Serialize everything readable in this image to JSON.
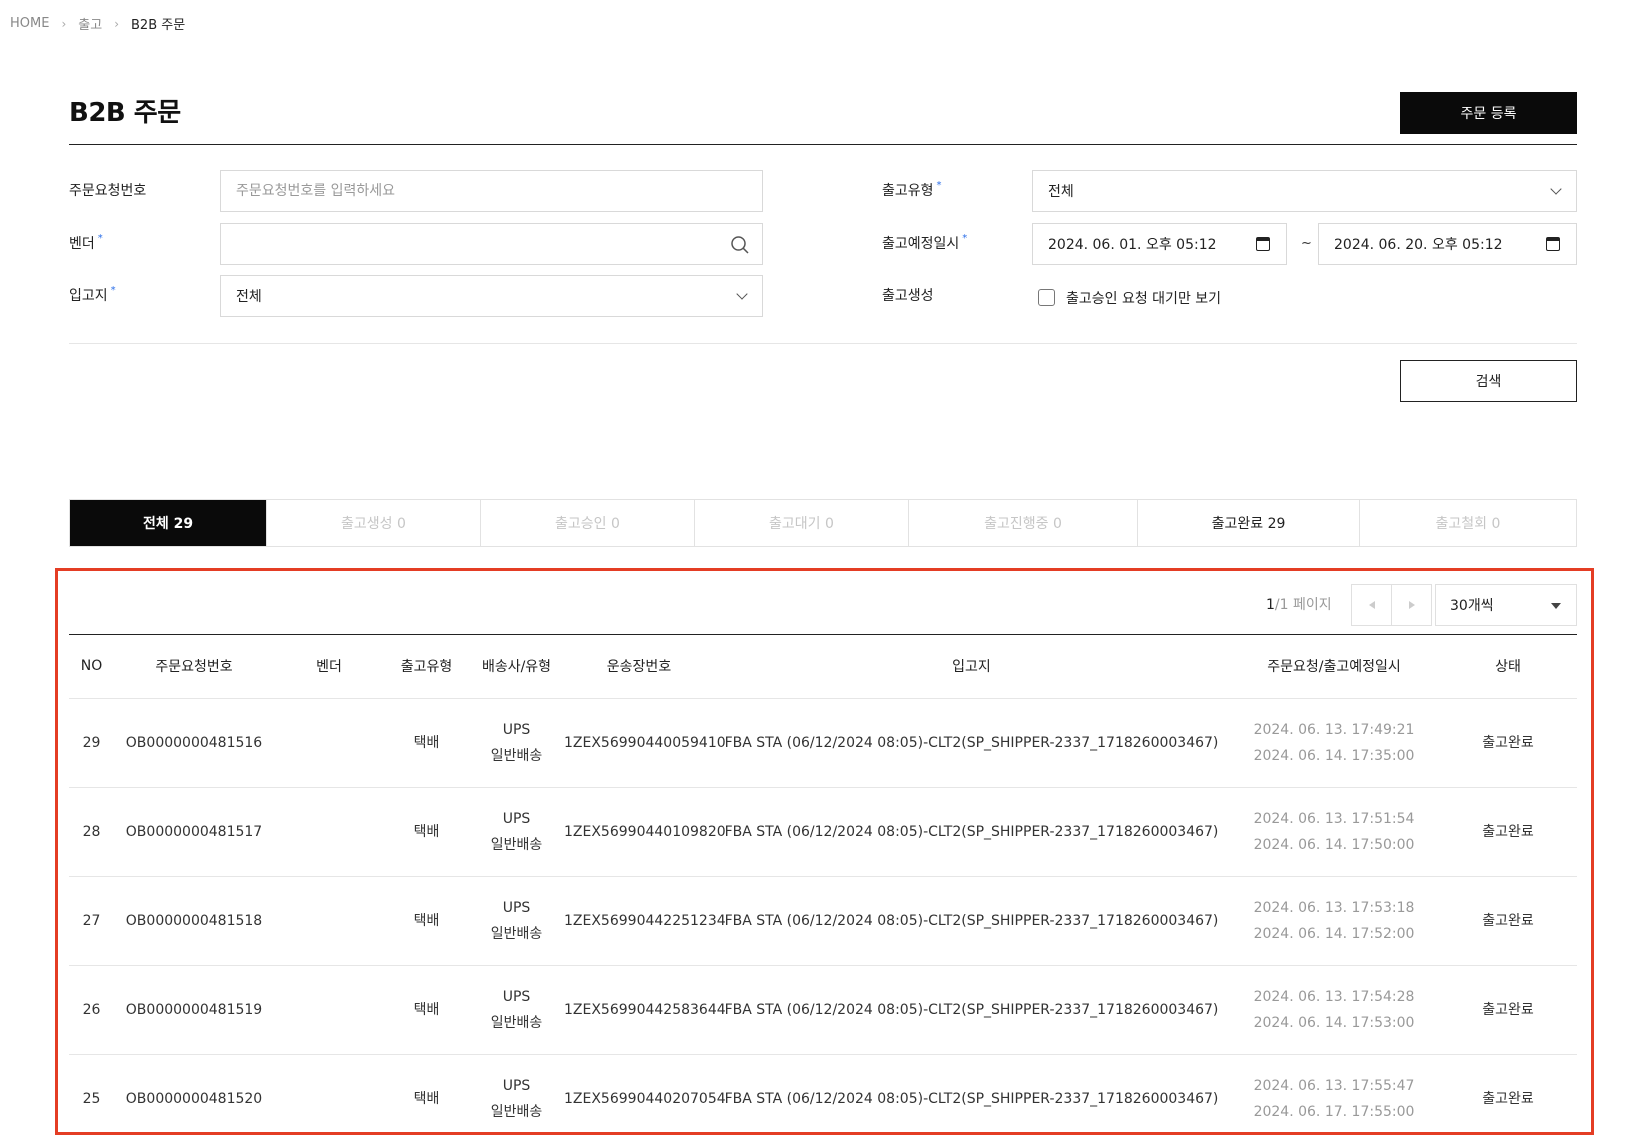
{
  "breadcrumb": [
    "HOME",
    "출고",
    "B2B 주문"
  ],
  "page_title": "B2B 주문",
  "register_button": "주문 등록",
  "form": {
    "order_no_label": "주문요청번호",
    "order_no_placeholder": "주문요청번호를 입력하세요",
    "vendor_label": "벤더",
    "warehouse_label": "입고지",
    "warehouse_value": "전체",
    "ship_type_label": "출고유형",
    "ship_type_value": "전체",
    "ship_date_label": "출고예정일시",
    "date_from": "2024. 06. 01. 오후 05:12",
    "date_to": "2024. 06. 20. 오후 05:12",
    "date_sep": "~",
    "create_label": "출고생성",
    "checkbox_label": "출고승인 요청 대기만 보기",
    "required_mark": "*"
  },
  "search_button": "검색",
  "tabs": [
    {
      "label": "전체 29",
      "state": "active"
    },
    {
      "label": "출고생성 0",
      "state": "disabled"
    },
    {
      "label": "출고승인 0",
      "state": "disabled"
    },
    {
      "label": "출고대기 0",
      "state": "disabled"
    },
    {
      "label": "출고진행중 0",
      "state": "disabled"
    },
    {
      "label": "출고완료 29",
      "state": "normal"
    },
    {
      "label": "출고철회 0",
      "state": "disabled"
    }
  ],
  "pager": {
    "current": "1",
    "total": "/1 페이지",
    "per_page": "30개씩"
  },
  "table": {
    "headers": [
      "NO",
      "주문요청번호",
      "벤더",
      "출고유형",
      "배송사/유형",
      "운송장번호",
      "입고지",
      "주문요청/출고예정일시",
      "상태"
    ],
    "rows": [
      {
        "no": "29",
        "order_no": "OB0000000481516",
        "vendor": "",
        "ship_type": "택배",
        "carrier": "UPS",
        "carrier_type": "일반배송",
        "tracking": "1ZEX56990440059410",
        "warehouse": "FBA STA (06/12/2024 08:05)-CLT2(SP_SHIPPER-2337_1718260003467)",
        "requested": "2024. 06. 13. 17:49:21",
        "scheduled": "2024. 06. 14. 17:35:00",
        "status": "출고완료"
      },
      {
        "no": "28",
        "order_no": "OB0000000481517",
        "vendor": "",
        "ship_type": "택배",
        "carrier": "UPS",
        "carrier_type": "일반배송",
        "tracking": "1ZEX56990440109820",
        "warehouse": "FBA STA (06/12/2024 08:05)-CLT2(SP_SHIPPER-2337_1718260003467)",
        "requested": "2024. 06. 13. 17:51:54",
        "scheduled": "2024. 06. 14. 17:50:00",
        "status": "출고완료"
      },
      {
        "no": "27",
        "order_no": "OB0000000481518",
        "vendor": "",
        "ship_type": "택배",
        "carrier": "UPS",
        "carrier_type": "일반배송",
        "tracking": "1ZEX56990442251234",
        "warehouse": "FBA STA (06/12/2024 08:05)-CLT2(SP_SHIPPER-2337_1718260003467)",
        "requested": "2024. 06. 13. 17:53:18",
        "scheduled": "2024. 06. 14. 17:52:00",
        "status": "출고완료"
      },
      {
        "no": "26",
        "order_no": "OB0000000481519",
        "vendor": "",
        "ship_type": "택배",
        "carrier": "UPS",
        "carrier_type": "일반배송",
        "tracking": "1ZEX56990442583644",
        "warehouse": "FBA STA (06/12/2024 08:05)-CLT2(SP_SHIPPER-2337_1718260003467)",
        "requested": "2024. 06. 13. 17:54:28",
        "scheduled": "2024. 06. 14. 17:53:00",
        "status": "출고완료"
      },
      {
        "no": "25",
        "order_no": "OB0000000481520",
        "vendor": "",
        "ship_type": "택배",
        "carrier": "UPS",
        "carrier_type": "일반배송",
        "tracking": "1ZEX56990440207054",
        "warehouse": "FBA STA (06/12/2024 08:05)-CLT2(SP_SHIPPER-2337_1718260003467)",
        "requested": "2024. 06. 13. 17:55:47",
        "scheduled": "2024. 06. 17. 17:55:00",
        "status": "출고완료"
      }
    ]
  },
  "colors": {
    "accent_dark": "#0a0a0a",
    "required_mark": "#2b6ee8",
    "highlight_border": "#e43d24"
  }
}
